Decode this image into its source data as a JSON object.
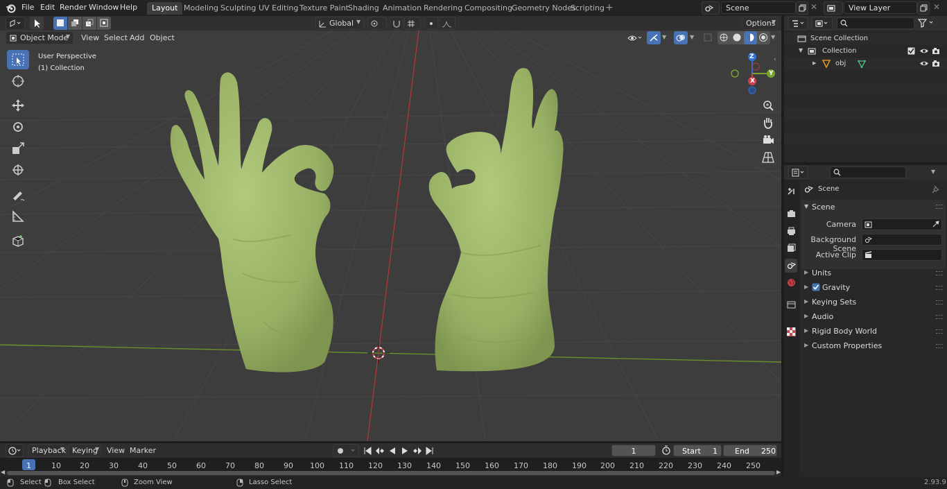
{
  "topbar": {
    "menus": [
      "File",
      "Edit",
      "Render",
      "Window",
      "Help"
    ],
    "workspaces": [
      "Layout",
      "Modeling",
      "Sculpting",
      "UV Editing",
      "Texture Paint",
      "Shading",
      "Animation",
      "Rendering",
      "Compositing",
      "Geometry Nodes",
      "Scripting"
    ],
    "active_workspace": "Layout",
    "scene_name": "Scene",
    "view_layer": "View Layer"
  },
  "viewport_header": {
    "mode": "Object Mode",
    "menus": [
      "View",
      "Select",
      "Add",
      "Object"
    ],
    "orientation": "Global",
    "options": "Options"
  },
  "viewport": {
    "perspective": "User Perspective",
    "collection": "(1) Collection",
    "gizmo_axes": [
      "X",
      "Y",
      "Z"
    ]
  },
  "outliner": {
    "items": [
      {
        "label": "Scene Collection",
        "depth": 0
      },
      {
        "label": "Collection",
        "depth": 1
      },
      {
        "label": "obj",
        "depth": 2
      }
    ]
  },
  "properties": {
    "context": "Scene",
    "panel": "Scene",
    "fields": [
      {
        "label": "Camera",
        "value": ""
      },
      {
        "label": "Background Scene",
        "value": ""
      },
      {
        "label": "Active Clip",
        "value": ""
      }
    ],
    "subpanels": [
      {
        "label": "Units",
        "checkbox": false
      },
      {
        "label": "Gravity",
        "checkbox": true
      },
      {
        "label": "Keying Sets",
        "checkbox": false
      },
      {
        "label": "Audio",
        "checkbox": false
      },
      {
        "label": "Rigid Body World",
        "checkbox": false
      },
      {
        "label": "Custom Properties",
        "checkbox": false
      }
    ]
  },
  "timeline": {
    "menus": [
      "Playback",
      "Keying",
      "View",
      "Marker"
    ],
    "current_frame": "1",
    "start_label": "Start",
    "start_value": "1",
    "end_label": "End",
    "end_value": "250",
    "ruler": [
      "1",
      "10",
      "20",
      "30",
      "40",
      "50",
      "60",
      "70",
      "80",
      "90",
      "100",
      "110",
      "120",
      "130",
      "140",
      "150",
      "160",
      "170",
      "180",
      "190",
      "200",
      "210",
      "220",
      "230",
      "240",
      "250"
    ]
  },
  "statusbar": {
    "hints": [
      "Select",
      "Box Select",
      "Zoom View",
      "Lasso Select"
    ],
    "version": "2.93.9"
  },
  "colors": {
    "accent": "#4772b3",
    "mesh": "#9db56a",
    "x_axis": "#d0404a",
    "y_axis": "#7aa22f",
    "z_axis": "#2f72d6"
  }
}
